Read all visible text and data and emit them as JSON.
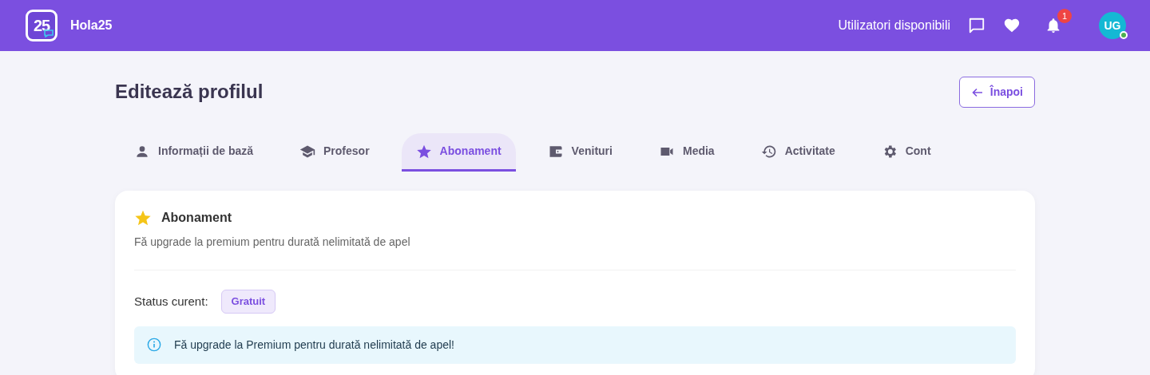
{
  "navbar": {
    "brand_logo": "25",
    "brand": "Hola25",
    "available_users_link": "Utilizatori disponibili",
    "notification_count": "1",
    "avatar_initials": "UG",
    "online": true
  },
  "page": {
    "title": "Editează profilul",
    "back_button": "Înapoi"
  },
  "tabs": [
    {
      "label": "Informații de bază",
      "selected": false
    },
    {
      "label": "Profesor",
      "selected": false
    },
    {
      "label": "Abonament",
      "selected": true
    },
    {
      "label": "Venituri",
      "selected": false
    },
    {
      "label": "Media",
      "selected": false
    },
    {
      "label": "Activitate",
      "selected": false
    },
    {
      "label": "Cont",
      "selected": false
    }
  ],
  "card": {
    "title": "Abonament",
    "subtitle": "Fă upgrade la premium pentru durată nelimitată de apel",
    "status_label": "Status curent:",
    "status_badge": "Gratuit",
    "alert": "Fă upgrade la Premium pentru durată nelimitată de apel!"
  }
}
